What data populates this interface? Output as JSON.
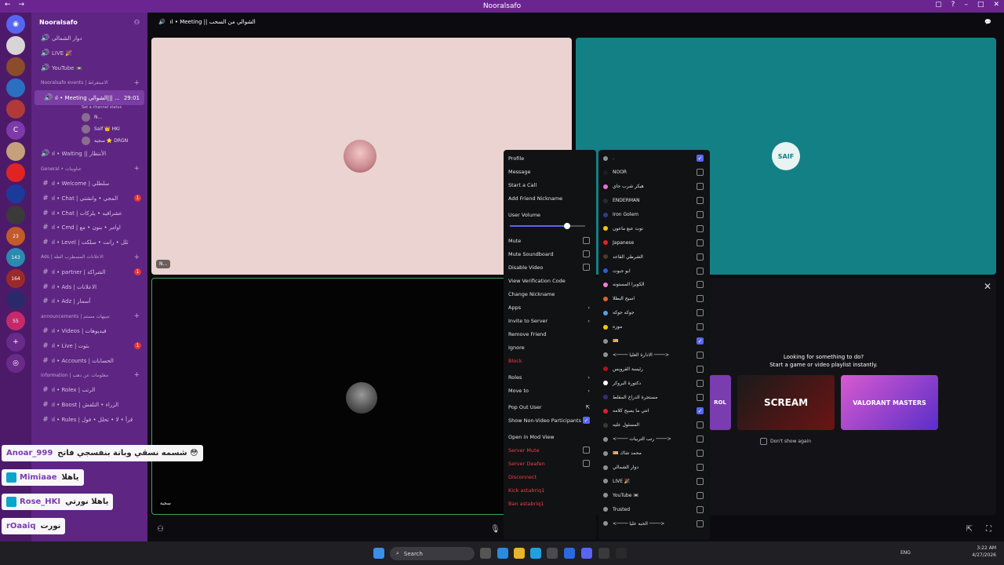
{
  "window": {
    "title": "Nooralsafo"
  },
  "server": {
    "name": "Nooralsafo"
  },
  "rail_badges": [
    "23",
    "143",
    "164",
    "55"
  ],
  "channels": [
    {
      "kind": "voice",
      "label": "دوار الشمالي",
      "badge": ""
    },
    {
      "kind": "voice",
      "label": "LIVE 🎉",
      "badge": ""
    },
    {
      "kind": "voice",
      "label": "YouTube 📼",
      "badge": ""
    },
    {
      "kind": "cat",
      "label": "Nooralsafo events | الاستقراط"
    },
    {
      "kind": "voice",
      "label": "ıl • Meeting الشوالي||| ...",
      "badge": "",
      "active": true,
      "time": "29:01"
    },
    {
      "kind": "status",
      "label": "Set a channel status"
    },
    {
      "kind": "vuser",
      "label": "N..."
    },
    {
      "kind": "vuser",
      "label": "Saif 👑 HKI"
    },
    {
      "kind": "vuser",
      "label": "سجية ⭐ DRGN"
    },
    {
      "kind": "voice",
      "label": "ıl • Waiting || الأنتظار",
      "badge": ""
    },
    {
      "kind": "cat",
      "label": "General • عناوينات"
    },
    {
      "kind": "text",
      "label": "ıl • Welcome | سلطلي",
      "badge": ""
    },
    {
      "kind": "text",
      "label": "ıl • Chat | المجي • وانشتي",
      "badge": "1"
    },
    {
      "kind": "text",
      "label": "ıl • Chat | عشرافيه • يلركات",
      "badge": ""
    },
    {
      "kind": "text",
      "label": "ıl • Cmd | اوامر • بنون • مع",
      "badge": ""
    },
    {
      "kind": "text",
      "label": "ıl • Level | ثلل • رانت • سلكت",
      "badge": ""
    },
    {
      "kind": "cat",
      "label": "Ads | الاعلانات المسطرب الطه"
    },
    {
      "kind": "text",
      "label": "ıl • partner | الشراكة",
      "badge": "1"
    },
    {
      "kind": "text",
      "label": "ıl • Ads | الاعلانات",
      "badge": ""
    },
    {
      "kind": "text",
      "label": "ıl • Adz | أسمار",
      "badge": ""
    },
    {
      "kind": "cat",
      "label": "announcements | تنبيهات مستم"
    },
    {
      "kind": "text",
      "label": "ıl • Videos | فيديوهات",
      "badge": ""
    },
    {
      "kind": "text",
      "label": "ıl • Live | بثوت",
      "badge": "1"
    },
    {
      "kind": "text",
      "label": "ıl • Accounts | الحسابات",
      "badge": ""
    },
    {
      "kind": "cat",
      "label": "information | معلومات عن دهب"
    },
    {
      "kind": "text",
      "label": "ıl • Rolex | الرتب",
      "badge": ""
    },
    {
      "kind": "text",
      "label": "ıl • Boost | الزراء • التلفش",
      "badge": ""
    },
    {
      "kind": "text",
      "label": "ıl • Rules | قرأ • لا • تحلل • فول",
      "badge": ""
    }
  ],
  "voice_header": {
    "title": "ıl • Meeting || الشوالي من السحب"
  },
  "tiles": [
    {
      "name": "N..."
    },
    {
      "name": "SAIF"
    },
    {
      "name": "سجية"
    }
  ],
  "activity": {
    "heading": "Looking for something to do?",
    "sub": "Start a game or video playlist instantly.",
    "games": [
      "ROL",
      "SCREAM",
      "VALORANT MASTERS"
    ],
    "dont_show": "Don't show again"
  },
  "context_menu": {
    "items": [
      {
        "label": "Profile"
      },
      {
        "label": "Message"
      },
      {
        "label": "Start a Call"
      },
      {
        "label": "Add Friend Nickname"
      }
    ],
    "volume_label": "User Volume",
    "volume_value": 0.76,
    "toggles": [
      {
        "label": "Mute",
        "checked": false
      },
      {
        "label": "Mute Soundboard",
        "checked": false
      },
      {
        "label": "Disable Video",
        "checked": false
      }
    ],
    "items2": [
      {
        "label": "View Verification Code",
        "arrow": ""
      },
      {
        "label": "Change Nickname",
        "arrow": ""
      },
      {
        "label": "Apps",
        "arrow": "›"
      },
      {
        "label": "Invite to Server",
        "arrow": "›"
      },
      {
        "label": "Remove Friend",
        "arrow": ""
      },
      {
        "label": "Ignore",
        "arrow": ""
      },
      {
        "label": "Block",
        "arrow": "",
        "red": true
      }
    ],
    "items3": [
      {
        "label": "Roles",
        "arrow": "›"
      },
      {
        "label": "Move to",
        "arrow": "›"
      }
    ],
    "popout": "Pop Out User",
    "show_nonvideo": "Show Non-Video Participants",
    "mod": "Open in Mod View",
    "server_mute": "Server Mute",
    "server_deafen": "Server Deafen",
    "disconnect": "Disconnect",
    "kick": "Kick astabriq1",
    "ban": "Ban astabriq1"
  },
  "roles": [
    {
      "name": ".",
      "color": "#8e9297",
      "checked": true
    },
    {
      "name": "NOOR",
      "color": "#1e1e22",
      "checked": false
    },
    {
      "name": "هيكر شرب جاي",
      "color": "#e86fd5",
      "checked": false
    },
    {
      "name": "ENDERMAN",
      "color": "#2a2a2e",
      "checked": false
    },
    {
      "name": "Iron Golem",
      "color": "#2e3a8c",
      "checked": false
    },
    {
      "name": "توت عنع ماعون",
      "color": "#f0c419",
      "checked": false
    },
    {
      "name": "Japanese",
      "color": "#e02424",
      "checked": false
    },
    {
      "name": "الشرطي القاعد",
      "color": "#4a3b2a",
      "checked": false
    },
    {
      "name": "ابو جبوت",
      "color": "#2c5bd8",
      "checked": false
    },
    {
      "name": "الكوبرا المستونه",
      "color": "#f27fd0",
      "checked": false
    },
    {
      "name": "اسيح البطلا",
      "color": "#d9652b",
      "checked": false
    },
    {
      "name": "جوكه جوكه",
      "color": "#5a9de6",
      "checked": false
    },
    {
      "name": "موزه",
      "color": "#f3c517",
      "checked": false
    },
    {
      "name": "🎫",
      "color": "#8e9297",
      "checked": true
    },
    {
      "name": "<──── الادارة العليا ────>",
      "color": "#8e9297",
      "checked": false
    },
    {
      "name": "رئيسة القروبس",
      "color": "#b3121a",
      "checked": false
    },
    {
      "name": "دكتورة البروكر",
      "color": "#ffffff",
      "checked": false
    },
    {
      "name": "مستجرة الدراخ المقلط",
      "color": "#3a2a7a",
      "checked": false
    },
    {
      "name": "انتي ما يصيح كلامه",
      "color": "#e0202a",
      "checked": true
    },
    {
      "name": "المسئول عليه",
      "color": "#3a3a30",
      "checked": false
    },
    {
      "name": "<──── رتب التربيات ────>",
      "color": "#8e9297",
      "checked": false
    },
    {
      "name": "🎫 محمد شاك",
      "color": "#8e9297",
      "checked": false
    },
    {
      "name": "دوار الشمالي",
      "color": "#8e9297",
      "checked": false
    },
    {
      "name": "LIVE 🎉",
      "color": "#8e9297",
      "checked": false
    },
    {
      "name": "YouTube 📼",
      "color": "#8e9297",
      "checked": false
    },
    {
      "name": "Trusted",
      "color": "#8e9297",
      "checked": false
    },
    {
      "name": "<──── الحبه عليا ────>",
      "color": "#8e9297",
      "checked": false
    }
  ],
  "stream_chat": [
    {
      "user": "Anoar_999",
      "text": "شسمه نسقي وبانة بنفسجي فاتح 😳"
    },
    {
      "user": "Mimiaae",
      "text": "ياهلا"
    },
    {
      "user": "Rose_HKI",
      "text": "ياهلا نورتي"
    },
    {
      "user": "rOaaiq",
      "text": "نورت"
    },
    {
      "user": "Anoar_999",
      "text": ""
    }
  ],
  "taskbar": {
    "search": "Search",
    "lang": "ENG",
    "time": "3:22 AM",
    "date": "4/27/2026"
  }
}
